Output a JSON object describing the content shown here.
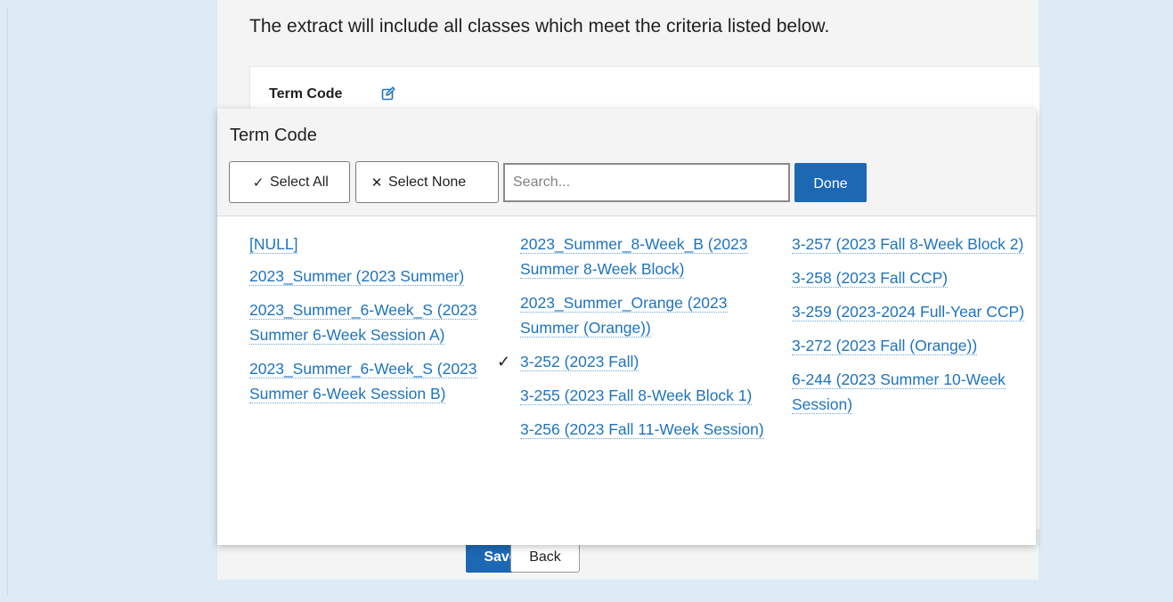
{
  "intro_text": "The extract will include all classes which meet the criteria listed below.",
  "card": {
    "field_label": "Term Code",
    "edit_icon": "edit-icon"
  },
  "actions": {
    "save_label": "Save",
    "back_label": "Back"
  },
  "popup": {
    "title": "Term Code",
    "select_all_label": "Select All",
    "select_none_label": "Select None",
    "search_placeholder": "Search...",
    "search_value": "",
    "done_label": "Done",
    "columns": [
      [
        {
          "label": "[NULL]",
          "checked": false
        },
        {
          "label": "2023_Summer (2023 Summer)",
          "checked": false
        },
        {
          "label": "2023_Summer_6-Week_S (2023 Summer 6-Week Session A)",
          "checked": false
        },
        {
          "label": "2023_Summer_6-Week_S (2023 Summer 6-Week Session B)",
          "checked": false
        }
      ],
      [
        {
          "label": "2023_Summer_8-Week_B (2023 Summer 8-Week Block)",
          "checked": false
        },
        {
          "label": "2023_Summer_Orange (2023 Summer (Orange))",
          "checked": false
        },
        {
          "label": "3-252 (2023 Fall)",
          "checked": true
        },
        {
          "label": "3-255 (2023 Fall 8-Week Block 1)",
          "checked": false
        },
        {
          "label": "3-256 (2023 Fall 11-Week Session)",
          "checked": false
        }
      ],
      [
        {
          "label": "3-257 (2023 Fall 8-Week Block 2)",
          "checked": false
        },
        {
          "label": "3-258 (2023 Fall CCP)",
          "checked": false
        },
        {
          "label": "3-259 (2023-2024 Full-Year CCP)",
          "checked": false
        },
        {
          "label": "3-272 (2023 Fall (Orange))",
          "checked": false
        },
        {
          "label": "6-244 (2023 Summer 10-Week Session)",
          "checked": false
        }
      ]
    ]
  },
  "colors": {
    "link": "#1e73be",
    "primary_button": "#1d68b3",
    "background": "#dcebf4"
  }
}
